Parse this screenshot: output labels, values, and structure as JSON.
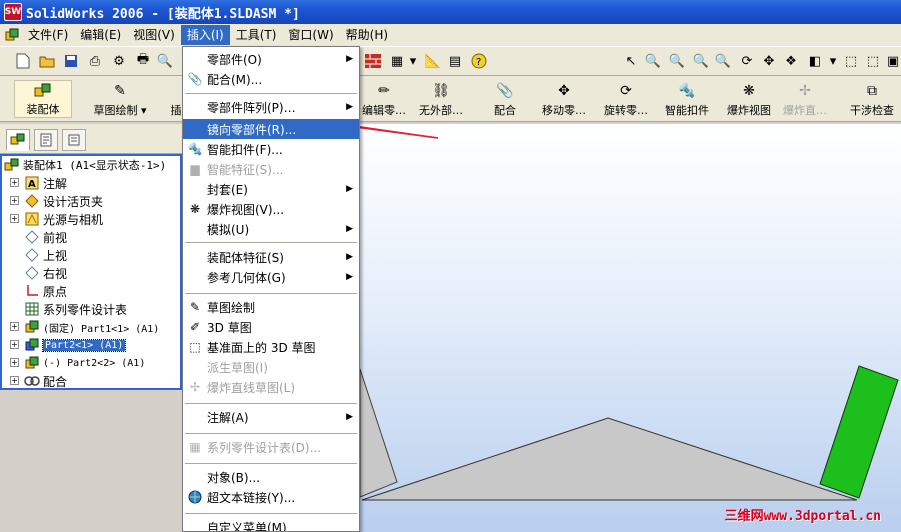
{
  "window": {
    "title": "SolidWorks 2006 - [装配体1.SLDASM *]",
    "logo": "SW"
  },
  "menubar": {
    "items": [
      {
        "label": "文件(F)"
      },
      {
        "label": "编辑(E)"
      },
      {
        "label": "视图(V)"
      },
      {
        "label": "插入(I)",
        "active": true
      },
      {
        "label": "工具(T)"
      },
      {
        "label": "窗口(W)"
      },
      {
        "label": "帮助(H)"
      }
    ]
  },
  "command_manager": {
    "left_buttons": [
      {
        "label": "装配体",
        "icon": "assembly-icon"
      },
      {
        "label": "草图绘制",
        "icon": "sketch-icon"
      },
      {
        "label": "插"
      }
    ],
    "right_buttons": [
      {
        "label": "编辑零…",
        "icon": "edit-part-icon"
      },
      {
        "label": "无外部…",
        "icon": "no-external-icon"
      },
      {
        "label": "配合",
        "icon": "mate-icon"
      },
      {
        "label": "移动零…",
        "icon": "move-component-icon"
      },
      {
        "label": "旋转零…",
        "icon": "rotate-component-icon"
      },
      {
        "label": "智能扣件",
        "icon": "smart-fastener-icon"
      },
      {
        "label": "爆炸视图",
        "icon": "exploded-view-icon"
      },
      {
        "label": "爆炸直…",
        "icon": "explode-line-icon",
        "disabled": true
      },
      {
        "label": "干涉检查",
        "icon": "interference-icon"
      }
    ]
  },
  "tree": {
    "root": "装配体1  (A1<显示状态-1>)",
    "items": [
      {
        "label": "注解"
      },
      {
        "label": "设计活页夹"
      },
      {
        "label": "光源与相机"
      },
      {
        "label": "前视"
      },
      {
        "label": "上视"
      },
      {
        "label": "右视"
      },
      {
        "label": "原点"
      },
      {
        "label": "系列零件设计表"
      },
      {
        "label": "(固定) Part1<1> (A1)"
      },
      {
        "label": "Part2<1> (A1)"
      },
      {
        "label": "(-) Part2<2> (A1)"
      },
      {
        "label": "配合"
      }
    ]
  },
  "insert_menu": {
    "items": [
      {
        "label": "零部件(O)",
        "submenu": true
      },
      {
        "label": "配合(M)..."
      },
      {
        "label": "零部件阵列(P)…",
        "submenu": true
      },
      {
        "label": "镜向零部件(R)...",
        "highlighted": true
      },
      {
        "label": "智能扣件(F)..."
      },
      {
        "label": "智能特征(S)...",
        "disabled": true
      },
      {
        "label": "封套(E)",
        "submenu": true
      },
      {
        "label": "爆炸视图(V)..."
      },
      {
        "label": "模拟(U)",
        "submenu": true
      },
      {
        "label": "装配体特征(S)",
        "submenu": true
      },
      {
        "label": "参考几何体(G)",
        "submenu": true
      },
      {
        "label": "草图绘制"
      },
      {
        "label": "3D 草图"
      },
      {
        "label": "基准面上的 3D 草图"
      },
      {
        "label": "派生草图(I)",
        "disabled": true
      },
      {
        "label": "爆炸直线草图(L)",
        "disabled": true
      },
      {
        "label": "注解(A)",
        "submenu": true
      },
      {
        "label": "系列零件设计表(D)...",
        "disabled": true
      },
      {
        "label": "对象(B)..."
      },
      {
        "label": "超文本链接(Y)..."
      },
      {
        "label": "自定义菜单(M)"
      }
    ]
  },
  "watermark": "三维网www.3dportal.cn",
  "colors": {
    "accent": "#316ac5",
    "part_green": "#1cbf1c",
    "part_gray": "#c8c8c8",
    "annotation_red": "#e0203a"
  }
}
